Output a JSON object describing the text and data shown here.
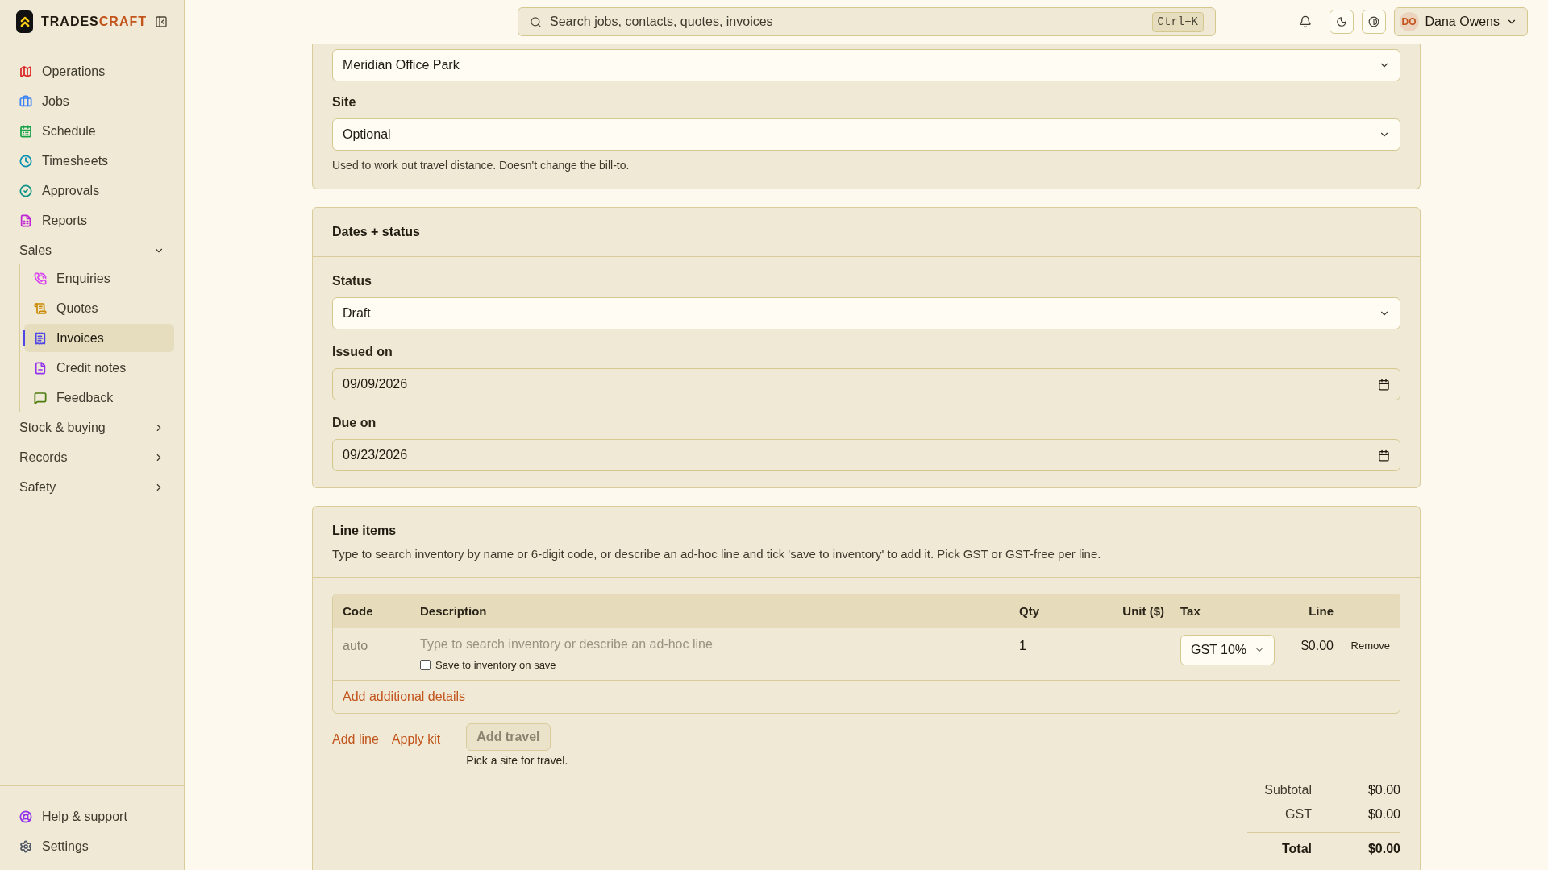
{
  "brand": {
    "name_first": "TRADES",
    "name_second": "CRAFT"
  },
  "sidebar": {
    "items": [
      {
        "kind": "link",
        "label": "Operations",
        "selected": false,
        "color": "#dc2626"
      },
      {
        "kind": "link",
        "label": "Jobs",
        "selected": false,
        "color": "#3b82f6"
      },
      {
        "kind": "link",
        "label": "Schedule",
        "selected": false,
        "color": "#16a34a"
      },
      {
        "kind": "link",
        "label": "Timesheets",
        "selected": false,
        "color": "#0891b2"
      },
      {
        "kind": "link",
        "label": "Approvals",
        "selected": false,
        "color": "#0d9488"
      },
      {
        "kind": "link",
        "label": "Reports",
        "selected": false,
        "color": "#c026d3"
      },
      {
        "kind": "group",
        "label": "Sales",
        "expanded": true,
        "children": [
          {
            "label": "Enquiries",
            "selected": false,
            "color": "#d946ef"
          },
          {
            "label": "Quotes",
            "selected": false,
            "color": "#ca8a04"
          },
          {
            "label": "Invoices",
            "selected": true,
            "color": "#4f46e5"
          },
          {
            "label": "Credit notes",
            "selected": false,
            "color": "#9333ea"
          },
          {
            "label": "Feedback",
            "selected": false,
            "color": "#4d7c0f"
          }
        ]
      },
      {
        "kind": "group",
        "label": "Stock & buying",
        "expanded": false
      },
      {
        "kind": "group",
        "label": "Records",
        "expanded": false
      },
      {
        "kind": "group",
        "label": "Safety",
        "expanded": false
      }
    ],
    "footer_items": [
      {
        "label": "Help & support",
        "color": "#9333ea"
      },
      {
        "label": "Settings",
        "color": "#4b5563"
      }
    ]
  },
  "header": {
    "search": {
      "placeholder": "Search jobs, contacts, quotes, invoices",
      "shortcut": "Ctrl+K"
    },
    "user": {
      "initials": "DO",
      "name": "Dana Owens"
    }
  },
  "customer_card": {
    "customer_value": "Meridian Office Park",
    "site": {
      "label": "Site",
      "value": "Optional",
      "hint": "Used to work out travel distance. Doesn't change the bill-to."
    }
  },
  "dates_status": {
    "title": "Dates + status",
    "status": {
      "label": "Status",
      "value": "Draft"
    },
    "issued_on": {
      "label": "Issued on",
      "value": "09/09/2026"
    },
    "due_on": {
      "label": "Due on",
      "value": "09/23/2026"
    }
  },
  "line_items": {
    "title": "Line items",
    "description": "Type to search inventory by name or 6-digit code, or describe an ad-hoc line and tick 'save to inventory' to add it. Pick GST or GST-free per line.",
    "table": {
      "columns": [
        "Code",
        "Description",
        "Qty",
        "Unit ($)",
        "Tax",
        "Line"
      ],
      "rows": [
        {
          "code": "auto",
          "description_placeholder": "Type to search inventory or describe an ad-hoc line",
          "save_to_inventory": {
            "label": "Save to inventory on save",
            "checked": false
          },
          "qty": "1",
          "tax": "GST 10%",
          "line": "$0.00",
          "remove": "Remove"
        }
      ]
    },
    "add_details": "Add additional details",
    "actions": {
      "add_line": "Add line",
      "apply_kit": "Apply kit",
      "add_travel": {
        "label": "Add travel",
        "disabled": true
      },
      "travel_hint": "Pick a site for travel."
    },
    "totals": [
      {
        "kind": "normal",
        "label": "Subtotal",
        "value": "$0.00"
      },
      {
        "kind": "normal",
        "label": "GST",
        "value": "$0.00"
      },
      {
        "kind": "grand",
        "label": "Total",
        "value": "$0.00"
      }
    ]
  }
}
